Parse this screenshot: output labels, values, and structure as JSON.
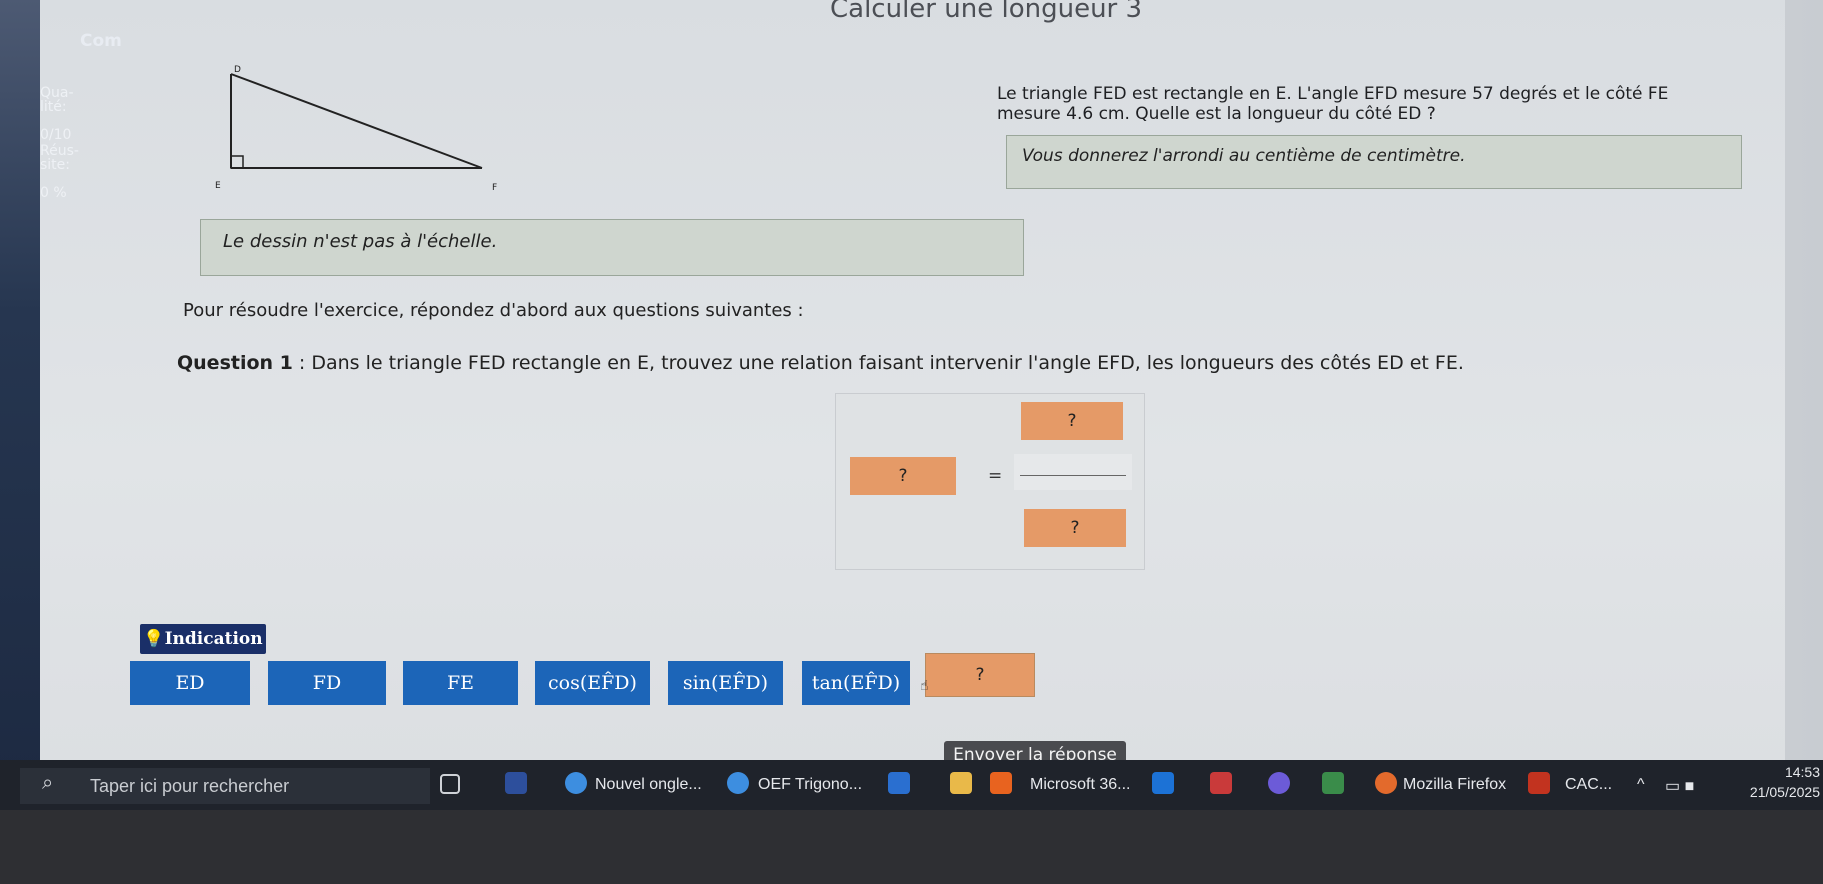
{
  "title": "Calculer une longueur 3",
  "sidebar": {
    "title": "Com",
    "quality_label": "Qua-\nlité:",
    "quality_value": "0/10",
    "success_label": "Réus-\nsite:",
    "success_value": "0 %"
  },
  "figure": {
    "vertex_d": "D",
    "vertex_e": "E",
    "vertex_f": "F"
  },
  "statement": {
    "line1": "Le triangle FED est rectangle en E. L'angle EFD mesure 57 degrés et le côté FE",
    "line2": "mesure 4.6 cm. Quelle est la longueur du côté ED ?",
    "rounding": "Vous donnerez l'arrondi au centième de centimètre."
  },
  "scale_note": "Le dessin n'est pas à l'échelle.",
  "intro": "Pour résoudre l'exercice, répondez d'abord aux questions suivantes :",
  "question": {
    "label": "Question 1",
    "text": " : Dans le triangle FED rectangle en E, trouvez une relation faisant intervenir l'angle EFD, les longueurs des côtés ED et FE."
  },
  "equation": {
    "left_slot": "?",
    "equals": "=",
    "numerator_slot": "?",
    "denominator_slot": "?"
  },
  "indication_label": "Indication",
  "chips": [
    "ED",
    "FD",
    "FE",
    "cos(EF̂D)",
    "sin(EF̂D)",
    "tan(EF̂D)"
  ],
  "blank_chip": "?",
  "submit_label": "Envoyer la réponse",
  "taskbar": {
    "search_placeholder": "Taper ici pour rechercher",
    "item_chrome1": "Nouvel ongle...",
    "item_chrome2": "OEF Trigono...",
    "item_office": "Microsoft 36...",
    "item_firefox": "Mozilla Firefox",
    "item_cac": "CAC...",
    "clock": "14:53",
    "date": "21/05/2025"
  },
  "colors": {
    "slot": "#e59a67",
    "chip": "#1c65b8",
    "indication": "#1a2f68"
  }
}
